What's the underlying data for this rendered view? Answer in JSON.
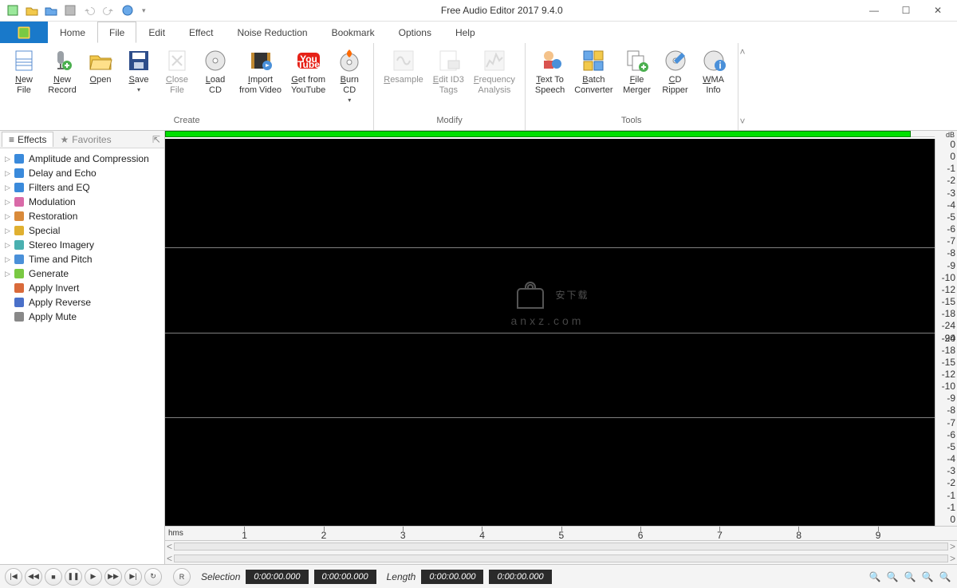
{
  "title": "Free Audio Editor 2017 9.4.0",
  "menus": [
    "Home",
    "File",
    "Edit",
    "Effect",
    "Noise Reduction",
    "Bookmark",
    "Options",
    "Help"
  ],
  "active_menu": "File",
  "ribbon_groups": [
    {
      "label": "Create",
      "buttons": [
        {
          "id": "new-file",
          "line1": "New",
          "line2": "File",
          "dd": false,
          "disabled": false
        },
        {
          "id": "new-record",
          "line1": "New",
          "line2": "Record",
          "dd": false,
          "disabled": false
        },
        {
          "id": "open",
          "line1": "Open",
          "line2": "",
          "dd": false,
          "disabled": false
        },
        {
          "id": "save",
          "line1": "Save",
          "line2": "",
          "dd": true,
          "disabled": false
        },
        {
          "id": "close-file",
          "line1": "Close",
          "line2": "File",
          "dd": false,
          "disabled": true
        },
        {
          "id": "load-cd",
          "line1": "Load",
          "line2": "CD",
          "dd": false,
          "disabled": false
        },
        {
          "id": "import-video",
          "line1": "Import",
          "line2": "from Video",
          "dd": false,
          "disabled": false
        },
        {
          "id": "get-youtube",
          "line1": "Get from",
          "line2": "YouTube",
          "dd": false,
          "disabled": false
        },
        {
          "id": "burn-cd",
          "line1": "Burn",
          "line2": "CD",
          "dd": true,
          "disabled": false
        }
      ]
    },
    {
      "label": "Modify",
      "buttons": [
        {
          "id": "resample",
          "line1": "Resample",
          "line2": "",
          "dd": false,
          "disabled": true
        },
        {
          "id": "edit-id3",
          "line1": "Edit ID3",
          "line2": "Tags",
          "dd": false,
          "disabled": true
        },
        {
          "id": "freq-analysis",
          "line1": "Frequency",
          "line2": "Analysis",
          "dd": false,
          "disabled": true
        }
      ]
    },
    {
      "label": "Tools",
      "buttons": [
        {
          "id": "tts",
          "line1": "Text To",
          "line2": "Speech",
          "dd": false,
          "disabled": false
        },
        {
          "id": "batch-conv",
          "line1": "Batch",
          "line2": "Converter",
          "dd": false,
          "disabled": false
        },
        {
          "id": "file-merger",
          "line1": "File",
          "line2": "Merger",
          "dd": false,
          "disabled": false
        },
        {
          "id": "cd-ripper",
          "line1": "CD",
          "line2": "Ripper",
          "dd": false,
          "disabled": false
        },
        {
          "id": "wma-info",
          "line1": "WMA",
          "line2": "Info",
          "dd": false,
          "disabled": false
        }
      ]
    }
  ],
  "side_tabs": {
    "effects": "Effects",
    "favorites": "Favorites"
  },
  "effects_tree": [
    {
      "label": "Amplitude and Compression",
      "expandable": true
    },
    {
      "label": "Delay and Echo",
      "expandable": true
    },
    {
      "label": "Filters and EQ",
      "expandable": true
    },
    {
      "label": "Modulation",
      "expandable": true
    },
    {
      "label": "Restoration",
      "expandable": true
    },
    {
      "label": "Special",
      "expandable": true
    },
    {
      "label": "Stereo Imagery",
      "expandable": true
    },
    {
      "label": "Time and Pitch",
      "expandable": true
    },
    {
      "label": "Generate",
      "expandable": true
    },
    {
      "label": "Apply Invert",
      "expandable": false
    },
    {
      "label": "Apply Reverse",
      "expandable": false
    },
    {
      "label": "Apply Mute",
      "expandable": false
    }
  ],
  "db_label": "dB",
  "db_ticks_top": [
    "0",
    "0",
    "-1",
    "-2",
    "-3",
    "-4",
    "-5",
    "-6",
    "-7",
    "-8",
    "-9",
    "-10",
    "-12",
    "-15",
    "-18",
    "-24",
    "-90"
  ],
  "db_ticks_bottom": [
    "-24",
    "-18",
    "-15",
    "-12",
    "-10",
    "-9",
    "-8",
    "-7",
    "-6",
    "-5",
    "-4",
    "-3",
    "-2",
    "-1",
    "-1",
    "0",
    "0"
  ],
  "time_unit": "hms",
  "time_ticks": [
    "1",
    "2",
    "3",
    "4",
    "5",
    "6",
    "7",
    "8",
    "9"
  ],
  "watermark": {
    "main": "安下载",
    "sub": "anxz.com"
  },
  "status": {
    "selection_label": "Selection",
    "length_label": "Length",
    "sel_start": "0:00:00.000",
    "sel_end": "0:00:00.000",
    "len_start": "0:00:00.000",
    "len_end": "0:00:00.000",
    "record_btn": "R"
  }
}
